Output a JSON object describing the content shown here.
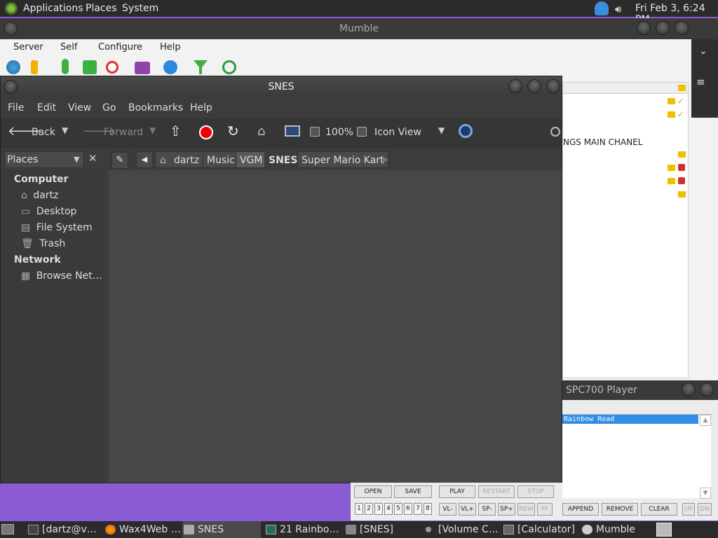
{
  "top_panel": {
    "menus": [
      "Applications",
      "Places",
      "System"
    ],
    "clock": "Fri Feb  3,  6:24 PM"
  },
  "mumble": {
    "title": "Mumble",
    "menu": [
      "Server",
      "Self",
      "Configure",
      "Help"
    ],
    "channel_text": "NGS MAIN CHANEL"
  },
  "snes": {
    "title": "SNES",
    "menu": [
      "File",
      "Edit",
      "View",
      "Go",
      "Bookmarks",
      "Help"
    ],
    "toolbar": {
      "back": "Back",
      "forward": "Forward",
      "zoom": "100%",
      "view_mode": "Icon View"
    },
    "places_selector": "Places",
    "breadcrumbs": [
      "dartz",
      "Music",
      "VGM",
      "SNES",
      "Super Mario Kart"
    ],
    "sidebar": {
      "computer_header": "Computer",
      "computer_items": [
        "dartz",
        "Desktop",
        "File System",
        "Trash"
      ],
      "network_header": "Network",
      "network_items": [
        "Browse Net…"
      ]
    }
  },
  "spc700": {
    "title": "SPC700 Player",
    "playlist": [
      "Rainbow Road"
    ],
    "buttons_row1": [
      "OPEN",
      "SAVE",
      "PLAY",
      "RESTART",
      "STOP"
    ],
    "numbers": [
      "1",
      "2",
      "3",
      "4",
      "5",
      "6",
      "7",
      "8"
    ],
    "buttons_row2": [
      "VL-",
      "VL+",
      "SP-",
      "SP+",
      "REW",
      "FF"
    ],
    "list_buttons": [
      "APPEND",
      "REMOVE",
      "CLEAR",
      "UP",
      "DN"
    ]
  },
  "taskbar": [
    "[dartz@v…",
    "Wax4Web …",
    "SNES",
    "21 Rainbo…",
    "[SNES]",
    "[Volume C…",
    "[Calculator]",
    "Mumble"
  ]
}
